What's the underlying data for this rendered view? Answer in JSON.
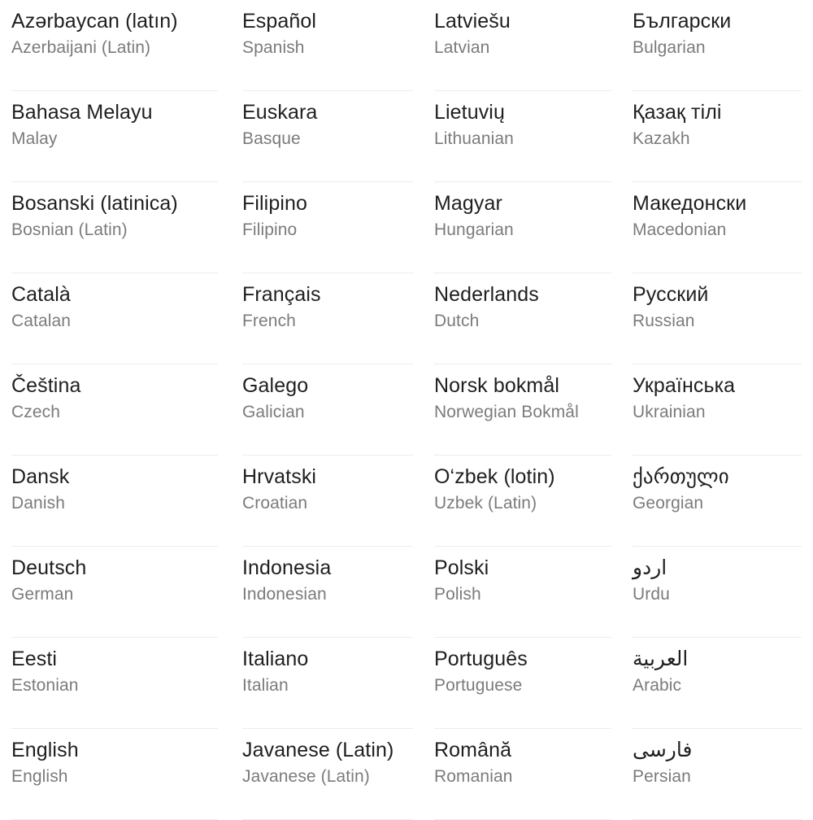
{
  "screen": {
    "name": "language-picker",
    "background_color": "#ffffff",
    "primary_text_color": "#1f1f1f",
    "secondary_text_color": "#7b7b7b",
    "divider_color": "#ececec"
  },
  "columns": [
    {
      "index": 0,
      "items": [
        {
          "native": "Azərbaycan (latın)",
          "english": "Azerbaijani (Latin)",
          "rtl": false
        },
        {
          "native": "Bahasa Melayu",
          "english": "Malay",
          "rtl": false
        },
        {
          "native": "Bosanski (latinica)",
          "english": "Bosnian (Latin)",
          "rtl": false
        },
        {
          "native": "Català",
          "english": "Catalan",
          "rtl": false
        },
        {
          "native": "Čeština",
          "english": "Czech",
          "rtl": false
        },
        {
          "native": "Dansk",
          "english": "Danish",
          "rtl": false
        },
        {
          "native": "Deutsch",
          "english": "German",
          "rtl": false
        },
        {
          "native": "Eesti",
          "english": "Estonian",
          "rtl": false
        },
        {
          "native": "English",
          "english": "English",
          "rtl": false
        }
      ]
    },
    {
      "index": 1,
      "items": [
        {
          "native": "Español",
          "english": "Spanish",
          "rtl": false
        },
        {
          "native": "Euskara",
          "english": "Basque",
          "rtl": false
        },
        {
          "native": "Filipino",
          "english": "Filipino",
          "rtl": false
        },
        {
          "native": "Français",
          "english": "French",
          "rtl": false
        },
        {
          "native": "Galego",
          "english": "Galician",
          "rtl": false
        },
        {
          "native": "Hrvatski",
          "english": "Croatian",
          "rtl": false
        },
        {
          "native": "Indonesia",
          "english": "Indonesian",
          "rtl": false
        },
        {
          "native": "Italiano",
          "english": "Italian",
          "rtl": false
        },
        {
          "native": "Javanese (Latin)",
          "english": "Javanese (Latin)",
          "rtl": false
        }
      ]
    },
    {
      "index": 2,
      "items": [
        {
          "native": "Latviešu",
          "english": "Latvian",
          "rtl": false
        },
        {
          "native": "Lietuvių",
          "english": "Lithuanian",
          "rtl": false
        },
        {
          "native": "Magyar",
          "english": "Hungarian",
          "rtl": false
        },
        {
          "native": "Nederlands",
          "english": "Dutch",
          "rtl": false
        },
        {
          "native": "Norsk bokmål",
          "english": "Norwegian Bokmål",
          "rtl": false
        },
        {
          "native": "O‘zbek (lotin)",
          "english": "Uzbek (Latin)",
          "rtl": false
        },
        {
          "native": "Polski",
          "english": "Polish",
          "rtl": false
        },
        {
          "native": "Português",
          "english": "Portuguese",
          "rtl": false
        },
        {
          "native": "Română",
          "english": "Romanian",
          "rtl": false
        }
      ]
    },
    {
      "index": 3,
      "items": [
        {
          "native": "Български",
          "english": "Bulgarian",
          "rtl": false
        },
        {
          "native": "Қазақ тілі",
          "english": "Kazakh",
          "rtl": false
        },
        {
          "native": "Македонски",
          "english": "Macedonian",
          "rtl": false
        },
        {
          "native": "Русский",
          "english": "Russian",
          "rtl": false
        },
        {
          "native": "Українська",
          "english": "Ukrainian",
          "rtl": false
        },
        {
          "native": "ქართული",
          "english": "Georgian",
          "rtl": false
        },
        {
          "native": "اردو",
          "english": "Urdu",
          "rtl": true
        },
        {
          "native": "العربية",
          "english": "Arabic",
          "rtl": true
        },
        {
          "native": "فارسی",
          "english": "Persian",
          "rtl": true
        }
      ]
    }
  ]
}
